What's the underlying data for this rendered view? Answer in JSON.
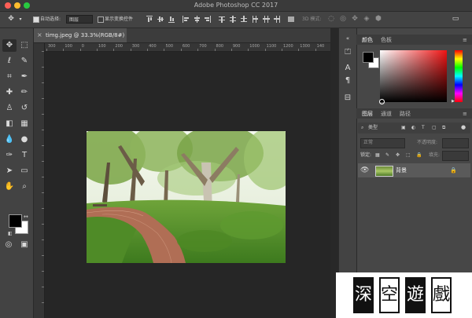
{
  "app": {
    "title": "Adobe Photoshop CC 2017",
    "traffic_lights": [
      "#ff5f57",
      "#febc2e",
      "#28c840"
    ]
  },
  "options_bar": {
    "move_icon": "move-arrows-icon",
    "auto_select_label": "自动选择:",
    "auto_select_checked": true,
    "auto_select_target": "图层",
    "show_transform_label": "显示变换控件",
    "show_transform_checked": false,
    "mode_3d_label": "3D 模式:"
  },
  "document": {
    "tab_close": "×",
    "tab_label": "timg.jpeg @ 33.3%(RGB/8#)",
    "ruler_ticks": [
      "300",
      "100",
      "0",
      "100",
      "200",
      "300",
      "400",
      "500",
      "600",
      "700",
      "800",
      "900",
      "1000",
      "1100",
      "1200",
      "1300",
      "140"
    ]
  },
  "toolbar": {
    "tools": [
      {
        "name": "move-tool",
        "glyph": "✥"
      },
      {
        "name": "marquee-tool",
        "glyph": "⬚"
      },
      {
        "name": "lasso-tool",
        "glyph": "ℓ"
      },
      {
        "name": "quick-select-tool",
        "glyph": "✎"
      },
      {
        "name": "crop-tool",
        "glyph": "⌗"
      },
      {
        "name": "eyedropper-tool",
        "glyph": "✒"
      },
      {
        "name": "healing-brush-tool",
        "glyph": "✚"
      },
      {
        "name": "brush-tool",
        "glyph": "✏"
      },
      {
        "name": "clone-stamp-tool",
        "glyph": "♙"
      },
      {
        "name": "history-brush-tool",
        "glyph": "↺"
      },
      {
        "name": "eraser-tool",
        "glyph": "◧"
      },
      {
        "name": "gradient-tool",
        "glyph": "▦"
      },
      {
        "name": "blur-tool",
        "glyph": "💧"
      },
      {
        "name": "dodge-tool",
        "glyph": "●"
      },
      {
        "name": "pen-tool",
        "glyph": "✑"
      },
      {
        "name": "type-tool",
        "glyph": "T"
      },
      {
        "name": "path-select-tool",
        "glyph": "➤"
      },
      {
        "name": "shape-tool",
        "glyph": "▭"
      },
      {
        "name": "hand-tool",
        "glyph": "✋"
      },
      {
        "name": "zoom-tool",
        "glyph": "⌕"
      }
    ],
    "foreground": "#000000",
    "background": "#ffffff"
  },
  "side_icons": [
    "A",
    "¶"
  ],
  "color_panel": {
    "tabs": [
      "颜色",
      "色板"
    ],
    "foreground": "#000000",
    "background": "#ffffff",
    "hue": "#f01414"
  },
  "layers_panel": {
    "tabs": [
      "图层",
      "通道",
      "路径"
    ],
    "filter_label": "类型",
    "blend_mode": "正常",
    "opacity_label": "不透明度:",
    "lock_label": "锁定:",
    "fill_label": "填充:",
    "layer": {
      "name": "背景",
      "eye_icon": "eye-icon",
      "lock_icon": "lock-icon"
    }
  },
  "watermark": {
    "chars": [
      "深",
      "空",
      "遊",
      "戲"
    ]
  }
}
